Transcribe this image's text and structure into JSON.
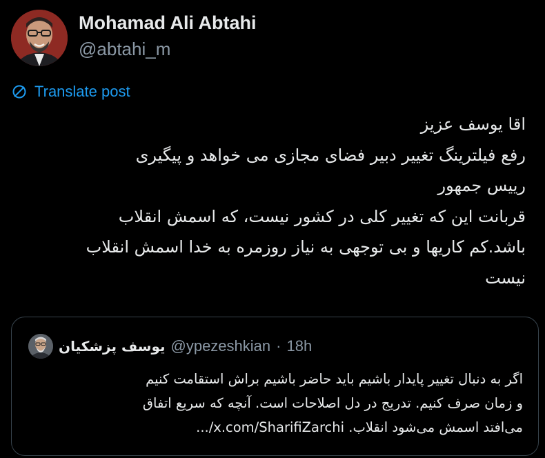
{
  "author": {
    "display_name": "Mohamad Ali Abtahi",
    "handle": "@abtahi_m",
    "avatar_icon": "profile-photo"
  },
  "translate": {
    "label": "Translate post",
    "icon": "translate-globe-icon",
    "color": "#1d9bf0"
  },
  "post": {
    "lines": [
      "اقا یوسف عزیز",
      "رفع فیلترینگ تغییر دبیر فضای مجازی می خواهد و پیگیری",
      "رییس جمهور",
      "قربانت این که تغییر کلی در کشور نیست، که اسمش انقلاب",
      "باشد.کم کاریها و بی توجهی به نیاز روزمره به خدا اسمش انقلاب",
      "نیست"
    ]
  },
  "quoted": {
    "display_name": "یوسف پزشکیان",
    "handle": "@ypezeshkian",
    "separator": "·",
    "time": "18h",
    "lines": [
      "اگر به دنبال تغییر پایدار باشیم باید حاضر باشیم براش استقامت کنیم",
      "و زمان صرف کنیم. تدریج در دل اصلاحات است. آنچه که سریع اتفاق",
      "می‌افتد اسمش می‌شود انقلاب. x.com/SharifiZarchi/..."
    ]
  },
  "colors": {
    "background": "#000000",
    "text": "#e7e9ea",
    "muted": "#8b98a5",
    "border": "#38444d",
    "accent": "#1d9bf0"
  }
}
